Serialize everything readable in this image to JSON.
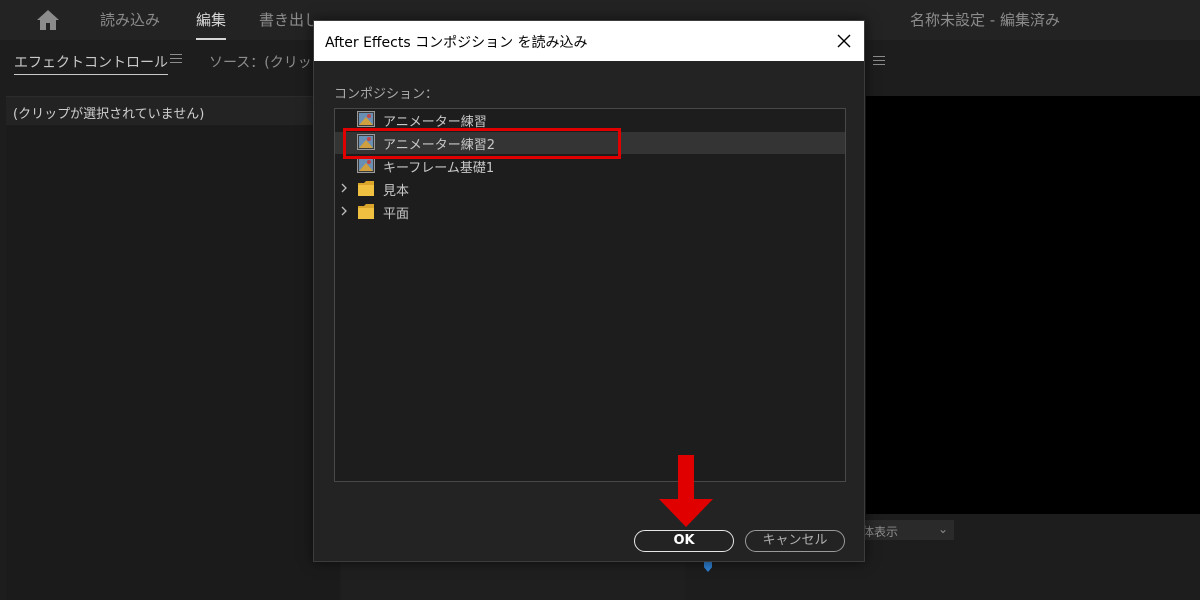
{
  "topbar": {
    "tabs": [
      "読み込み",
      "編集",
      "書き出し"
    ],
    "active_tab": 1,
    "project_title": "名称未設定 - 編集済み"
  },
  "left_panel": {
    "tab_effect": "エフェクトコントロール",
    "tab_source": "ソース：(クリップ",
    "clip_none": "(クリップが選択されていません)"
  },
  "program": {
    "fit_select": "体表示"
  },
  "dialog": {
    "title": "After Effects コンポジション を読み込み",
    "comp_label": "コンポジション：",
    "items": [
      {
        "type": "comp",
        "label": "アニメーター練習",
        "selected": false
      },
      {
        "type": "comp",
        "label": "アニメーター練習2",
        "selected": true
      },
      {
        "type": "comp",
        "label": "キーフレーム基礎1",
        "selected": false
      },
      {
        "type": "folder",
        "label": "見本",
        "selected": false
      },
      {
        "type": "folder",
        "label": "平面",
        "selected": false
      }
    ],
    "ok_label": "OK",
    "cancel_label": "キャンセル"
  },
  "colors": {
    "highlight": "#e00000",
    "arrow": "#e00000",
    "accent": "#2d7fd1"
  }
}
